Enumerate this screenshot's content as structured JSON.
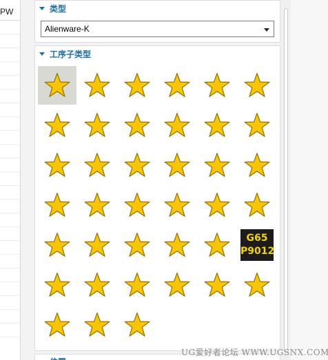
{
  "left_table": {
    "header": "PW",
    "row_count": 23
  },
  "type_group": {
    "title": "类型",
    "selected_value": "Alienware-K"
  },
  "subtype_group": {
    "title": "工序子类型",
    "items": [
      {
        "kind": "star",
        "selected": true
      },
      {
        "kind": "star"
      },
      {
        "kind": "star"
      },
      {
        "kind": "star"
      },
      {
        "kind": "star"
      },
      {
        "kind": "star"
      },
      {
        "kind": "star"
      },
      {
        "kind": "star"
      },
      {
        "kind": "star"
      },
      {
        "kind": "star"
      },
      {
        "kind": "star"
      },
      {
        "kind": "star"
      },
      {
        "kind": "star"
      },
      {
        "kind": "star"
      },
      {
        "kind": "star"
      },
      {
        "kind": "star"
      },
      {
        "kind": "star"
      },
      {
        "kind": "star"
      },
      {
        "kind": "star"
      },
      {
        "kind": "star"
      },
      {
        "kind": "star"
      },
      {
        "kind": "star"
      },
      {
        "kind": "star"
      },
      {
        "kind": "star"
      },
      {
        "kind": "star"
      },
      {
        "kind": "star"
      },
      {
        "kind": "star"
      },
      {
        "kind": "star"
      },
      {
        "kind": "star"
      },
      {
        "kind": "badge",
        "line1": "G65",
        "line2": "P9012"
      },
      {
        "kind": "star"
      },
      {
        "kind": "star"
      },
      {
        "kind": "star"
      },
      {
        "kind": "star"
      },
      {
        "kind": "star"
      },
      {
        "kind": "star"
      },
      {
        "kind": "star"
      },
      {
        "kind": "star"
      },
      {
        "kind": "star"
      }
    ]
  },
  "position_group": {
    "title": "位置"
  },
  "watermark": "UG爱好者论坛 WWW.UGSNX.COM",
  "colors": {
    "star_fill": "#f9c400",
    "star_stroke": "#8a6d00",
    "accent": "#1c6fa6"
  }
}
